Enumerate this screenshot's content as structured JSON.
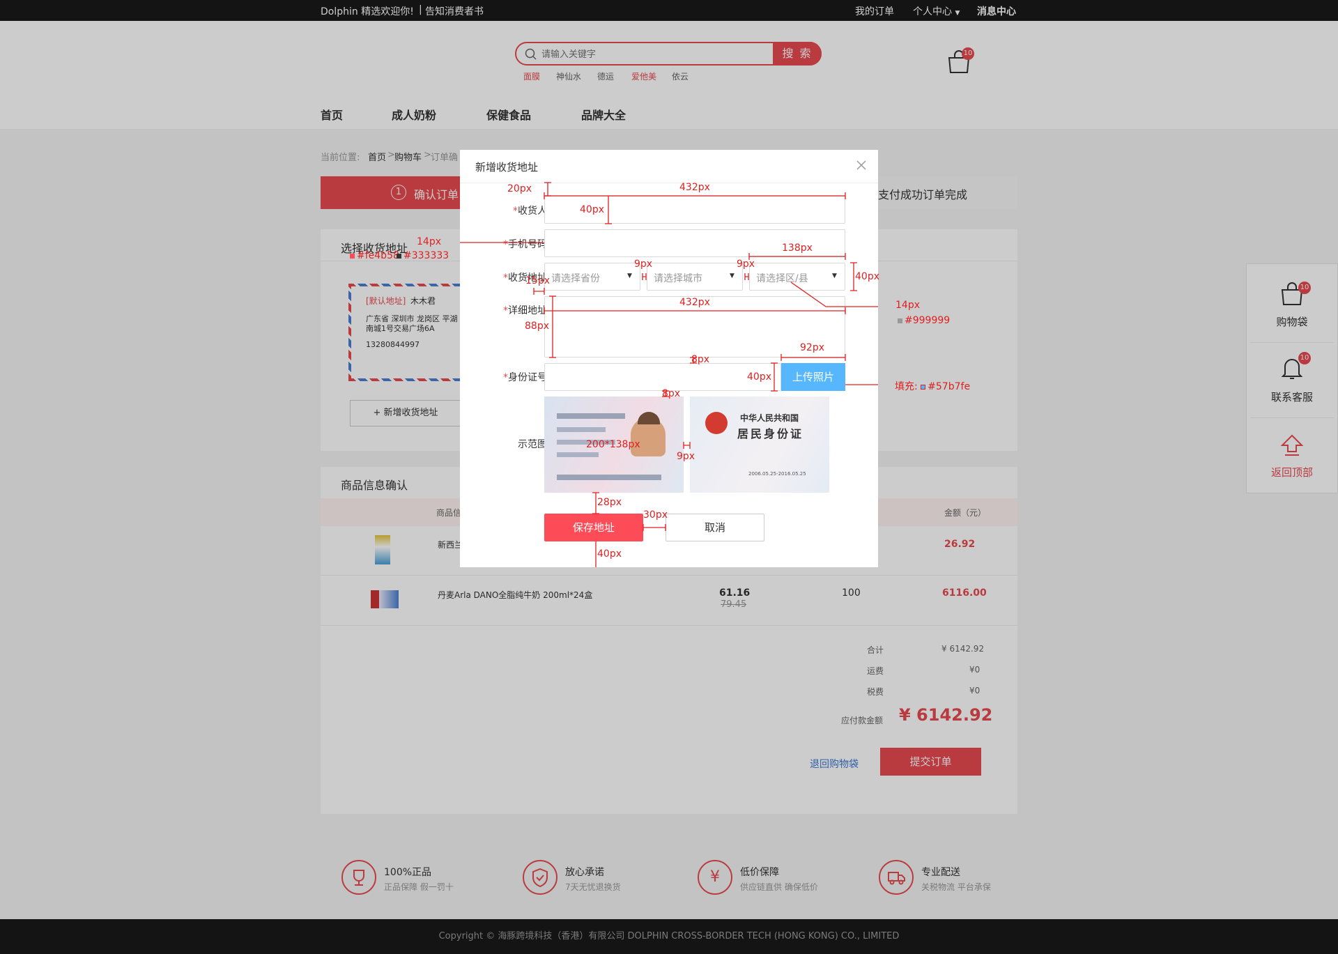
{
  "topbar": {
    "welcome": "Dolphin 精选欢迎你!",
    "notice": "告知消费者书",
    "orders": "我的订单",
    "personal": "个人中心",
    "messages": "消息中心"
  },
  "search": {
    "placeholder": "请输入关键字",
    "button": "搜 索",
    "hot": [
      "面膜",
      "神仙水",
      "德运",
      "爱他美",
      "依云"
    ]
  },
  "cart": {
    "badge": "10"
  },
  "nav": [
    "首页",
    "成人奶粉",
    "保健食品",
    "品牌大全"
  ],
  "breadcrumb": {
    "prefix": "当前位置:",
    "home": "首页",
    "cart": "购物车",
    "current": "订单确"
  },
  "steps": {
    "step1": "确认订单",
    "step1_num": "1",
    "step3": "支付成功订单完成"
  },
  "address": {
    "section_title": "选择收货地址",
    "default_tag": "[默认地址]",
    "name": "木木君",
    "line1": "广东省 深圳市 龙岗区 平湖",
    "line2": "南城1号交易广场6A",
    "phone": "13280844997",
    "add_btn": "+ 新增收货地址"
  },
  "goods": {
    "section_title": "商品信息确认",
    "header_info": "商品信",
    "header_amount": "金额（元）",
    "rows": [
      {
        "name": "新西兰",
        "amount": "26.92"
      },
      {
        "name": "丹麦Arla DANO全脂纯牛奶 200ml*24盒",
        "price": "61.16",
        "old_price": "79.45",
        "qty": "100",
        "amount": "6116.00"
      }
    ]
  },
  "summary": {
    "total_label": "合计",
    "total": "¥ 6142.92",
    "shipping_label": "运费",
    "shipping": "¥0",
    "tax_label": "税费",
    "tax": "¥0",
    "pay_label": "应付款金额",
    "pay": "¥ 6142.92",
    "back": "退回购物袋",
    "submit": "提交订单"
  },
  "sidebar": {
    "bag": "购物袋",
    "bag_badge": "10",
    "service": "联系客服",
    "service_badge": "10",
    "top": "返回顶部"
  },
  "features": [
    {
      "title": "100%正品",
      "sub": "正品保障  假一罚十",
      "icon": "trophy-icon"
    },
    {
      "title": "放心承诺",
      "sub": "7天无忧退换货",
      "icon": "shield-check-icon"
    },
    {
      "title": "低价保障",
      "sub": "供应链直供  确保低价",
      "icon": "yen-icon"
    },
    {
      "title": "专业配送",
      "sub": "关税物流 平台承保",
      "icon": "truck-icon"
    }
  ],
  "copyright": "Copyright ©  海豚跨境科技（香港）有限公司    DOLPHIN CROSS-BORDER TECH (HONG KONG) CO., LIMITED",
  "modal": {
    "title": "新增收货地址",
    "receiver_label": "收货人",
    "phone_label": "手机号码",
    "region_label": "收货地址",
    "province_ph": "请选择省份",
    "city_ph": "请选择城市",
    "district_ph": "请选择区/县",
    "detail_label": "详细地址",
    "id_label": "身份证号",
    "upload_btn": "上传照片",
    "sample_label": "示范图",
    "id_front": {
      "title1": "中华人民共和国",
      "title2": "居民身份证",
      "valid": "2006.05.25-2016.05.25"
    },
    "save": "保存地址",
    "cancel": "取消"
  },
  "annotations": {
    "a20": "20px",
    "a432a": "432px",
    "a40a": "40px",
    "a14a": "14px",
    "c_fe": "#fe4b58",
    "c_33": "#333333",
    "a9a": "9px",
    "a9b": "9px",
    "a138": "138px",
    "a40b": "40px",
    "a15": "15px",
    "a14b": "14px",
    "c_99": "#999999",
    "a432b": "432px",
    "a88": "88px",
    "a8a": "8px",
    "a92": "92px",
    "a40c": "40px",
    "fill": "填充:",
    "c_57": "#57b7fe",
    "a8b": "8px",
    "a200": "200*138px",
    "a9c": "9px",
    "a28": "28px",
    "a30": "30px",
    "a40d": "40px"
  },
  "colors": {
    "accent": "#e84a4f",
    "upload": "#57b7fe",
    "mark_red": "#fe4b58",
    "mark_dark": "#333333",
    "mark_gray": "#999999"
  }
}
